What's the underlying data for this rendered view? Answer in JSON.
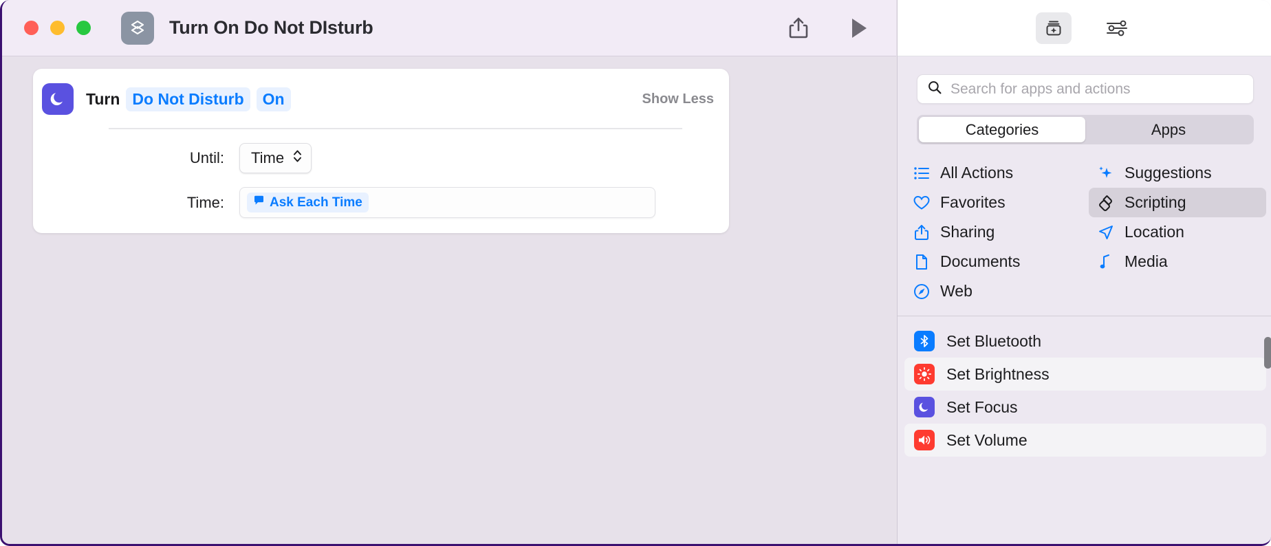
{
  "window": {
    "traffic_lights": [
      "close",
      "minimize",
      "maximize"
    ],
    "accent_border": "#3b1070"
  },
  "titlebar": {
    "doc_icon": "shortcuts-app-icon",
    "title": "Turn On Do Not DIsturb",
    "share_button": "share-icon",
    "play_button": "play-icon"
  },
  "action_card": {
    "icon": "moon-icon",
    "icon_color": "#5a51e0",
    "prefix": "Turn",
    "tokens": [
      "Do Not Disturb",
      "On"
    ],
    "show_less_label": "Show Less",
    "params": [
      {
        "label": "Until:",
        "type": "popup",
        "value": "Time"
      },
      {
        "label": "Time:",
        "type": "field",
        "value": "Ask Each Time",
        "value_icon": "ask-each-time-icon"
      }
    ]
  },
  "right_panel": {
    "header_buttons": [
      {
        "name": "action-library-icon",
        "active": true
      },
      {
        "name": "sliders-icon",
        "active": false
      }
    ],
    "search": {
      "placeholder": "Search for apps and actions",
      "icon": "search-icon",
      "value": ""
    },
    "segmented": {
      "options": [
        "Categories",
        "Apps"
      ],
      "selected": "Categories"
    },
    "categories": [
      {
        "label": "All Actions",
        "icon": "list-bullet-icon",
        "selected": false,
        "color": "#0a7cff"
      },
      {
        "label": "Suggestions",
        "icon": "sparkles-icon",
        "selected": false,
        "color": "#0a7cff"
      },
      {
        "label": "Favorites",
        "icon": "heart-icon",
        "selected": false,
        "color": "#0a7cff"
      },
      {
        "label": "Scripting",
        "icon": "scripting-icon",
        "selected": true,
        "color": "#1c1c1e"
      },
      {
        "label": "Sharing",
        "icon": "share-icon",
        "selected": false,
        "color": "#0a7cff"
      },
      {
        "label": "Location",
        "icon": "paper-plane-icon",
        "selected": false,
        "color": "#0a7cff"
      },
      {
        "label": "Documents",
        "icon": "document-icon",
        "selected": false,
        "color": "#0a7cff"
      },
      {
        "label": "Media",
        "icon": "music-note-icon",
        "selected": false,
        "color": "#0a7cff"
      },
      {
        "label": "Web",
        "icon": "compass-icon",
        "selected": false,
        "color": "#0a7cff"
      }
    ],
    "actions": [
      {
        "label": "Set Bluetooth",
        "icon": "bluetooth-icon",
        "color": "#0a7cff",
        "striped": false
      },
      {
        "label": "Set Brightness",
        "icon": "brightness-icon",
        "color": "#fe3b30",
        "striped": true
      },
      {
        "label": "Set Focus",
        "icon": "moon-icon",
        "color": "#5a51e0",
        "striped": false
      },
      {
        "label": "Set Volume",
        "icon": "speaker-icon",
        "color": "#fe3b30",
        "striped": true
      }
    ],
    "scrollbar": {
      "name": "action-list-scrollbar"
    }
  }
}
